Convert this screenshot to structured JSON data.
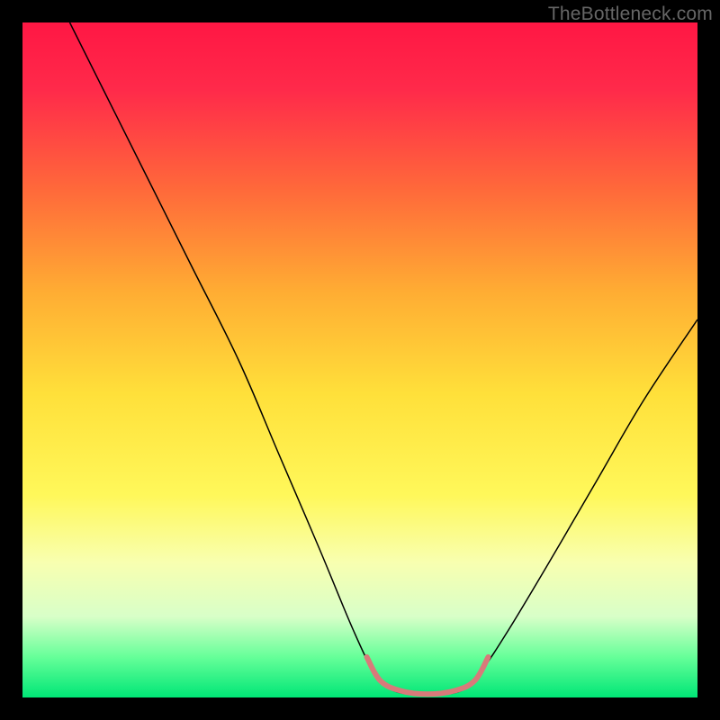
{
  "watermark": "TheBottleneck.com",
  "chart_data": {
    "type": "line",
    "title": "",
    "xlabel": "",
    "ylabel": "",
    "xlim": [
      0,
      100
    ],
    "ylim": [
      0,
      100
    ],
    "grid": false,
    "legend": false,
    "background": {
      "type": "vertical-gradient",
      "stops": [
        {
          "y": 0,
          "color": "#ff1744"
        },
        {
          "y": 10,
          "color": "#ff2a4a"
        },
        {
          "y": 25,
          "color": "#ff6a3a"
        },
        {
          "y": 40,
          "color": "#ffad33"
        },
        {
          "y": 55,
          "color": "#ffe03a"
        },
        {
          "y": 70,
          "color": "#fff85a"
        },
        {
          "y": 80,
          "color": "#f8ffb0"
        },
        {
          "y": 88,
          "color": "#d8ffc8"
        },
        {
          "y": 94,
          "color": "#66ff99"
        },
        {
          "y": 100,
          "color": "#00e676"
        }
      ]
    },
    "series": [
      {
        "name": "bottleneck-curve",
        "stroke": "#000000",
        "stroke_width": 1.5,
        "points": [
          {
            "x": 7,
            "y": 100
          },
          {
            "x": 12,
            "y": 90
          },
          {
            "x": 18,
            "y": 78
          },
          {
            "x": 25,
            "y": 64
          },
          {
            "x": 32,
            "y": 50
          },
          {
            "x": 38,
            "y": 36
          },
          {
            "x": 44,
            "y": 22
          },
          {
            "x": 49,
            "y": 10
          },
          {
            "x": 52,
            "y": 4
          },
          {
            "x": 55,
            "y": 1
          },
          {
            "x": 60,
            "y": 0.5
          },
          {
            "x": 65,
            "y": 1
          },
          {
            "x": 68,
            "y": 4
          },
          {
            "x": 72,
            "y": 10
          },
          {
            "x": 78,
            "y": 20
          },
          {
            "x": 85,
            "y": 32
          },
          {
            "x": 92,
            "y": 44
          },
          {
            "x": 100,
            "y": 56
          }
        ]
      },
      {
        "name": "optimal-zone-marker",
        "stroke": "#d87a7a",
        "stroke_width": 6,
        "points": [
          {
            "x": 51,
            "y": 6
          },
          {
            "x": 53,
            "y": 2.5
          },
          {
            "x": 56,
            "y": 1
          },
          {
            "x": 60,
            "y": 0.5
          },
          {
            "x": 64,
            "y": 1
          },
          {
            "x": 67,
            "y": 2.5
          },
          {
            "x": 69,
            "y": 6
          }
        ]
      }
    ]
  }
}
